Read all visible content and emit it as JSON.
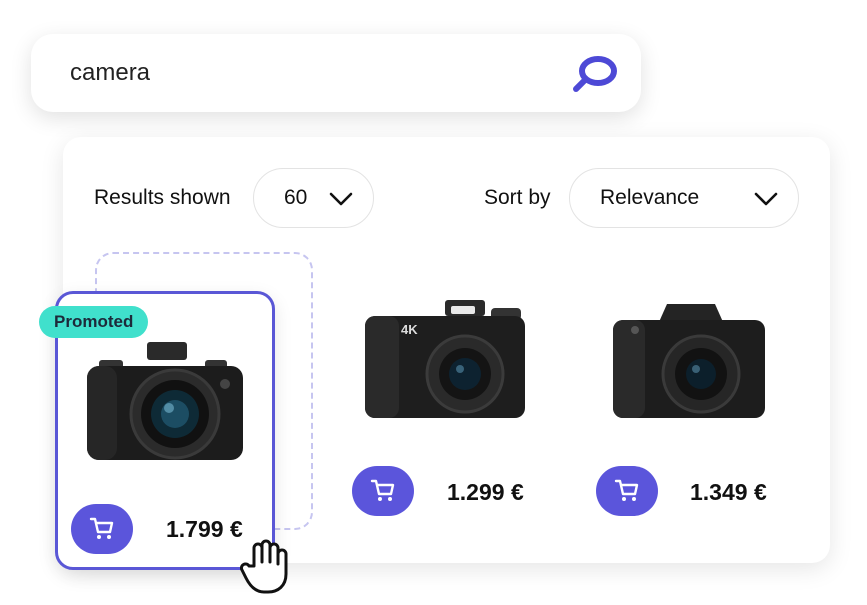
{
  "search": {
    "query": "camera"
  },
  "controls": {
    "results_label": "Results shown",
    "results_value": "60",
    "sort_label": "Sort by",
    "sort_value": "Relevance"
  },
  "products": [
    {
      "badge": "Promoted",
      "price": "1.799 €"
    },
    {
      "price": "1.299 €"
    },
    {
      "price": "1.349 €"
    }
  ],
  "colors": {
    "accent": "#5b55db",
    "badge": "#40e0cc",
    "card_border": "#5a57d6"
  }
}
